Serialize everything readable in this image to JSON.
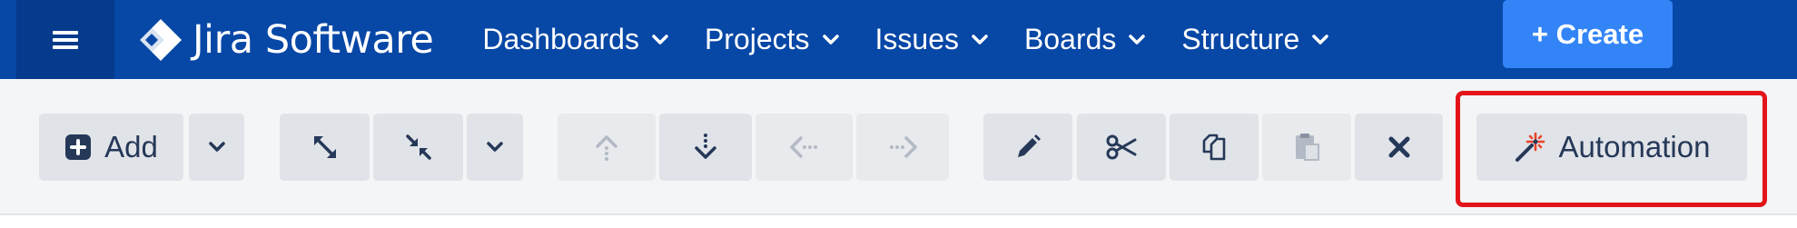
{
  "header": {
    "app_name": "Jira Software",
    "nav_items": [
      {
        "label": "Dashboards"
      },
      {
        "label": "Projects"
      },
      {
        "label": "Issues"
      },
      {
        "label": "Boards"
      },
      {
        "label": "Structure"
      }
    ],
    "create_label": "+ Create"
  },
  "toolbar": {
    "add_label": "Add",
    "automation_label": "Automation"
  },
  "colors": {
    "header_bg": "#0747a6",
    "menu_bg": "#053a8c",
    "create_bg": "#3385f7",
    "toolbar_bg": "#f4f5f7",
    "button_bg": "#e0e3e8",
    "highlight": "#e3151b"
  },
  "icons": [
    "hamburger-menu-icon",
    "jira-logo-icon",
    "chevron-down-icon",
    "plus-square-icon",
    "expand-icon",
    "collapse-icon",
    "move-up-icon",
    "move-down-icon",
    "move-left-icon",
    "move-right-icon",
    "pencil-icon",
    "scissors-icon",
    "copy-icon",
    "paste-icon",
    "close-icon",
    "magic-wand-icon"
  ]
}
